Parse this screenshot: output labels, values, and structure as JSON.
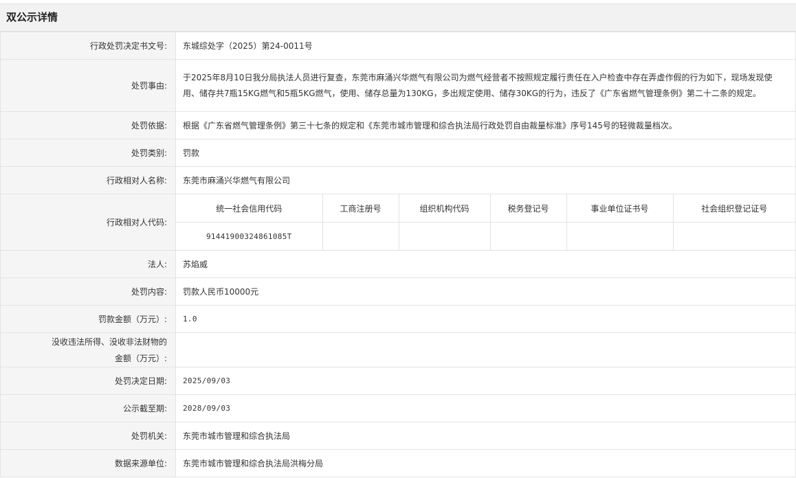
{
  "header": {
    "title": "双公示详情"
  },
  "rows": {
    "doc_no": {
      "label": "行政处罚决定书文号:",
      "value": "东城综处字（2025）第24-0011号"
    },
    "reason": {
      "label": "处罚事由:",
      "value": "于2025年8月10日我分局执法人员进行复查，东莞市麻涌兴华燃气有限公司为燃气经营者不按照规定履行责任在入户检查中存在弄虚作假的行为如下，现场发现使用、储存共7瓶15KG燃气和5瓶5KG燃气，使用、储存总量为130KG，多出规定使用、储存30KG的行为，违反了《广东省燃气管理条例》第二十二条的规定。"
    },
    "basis": {
      "label": "处罚依据:",
      "value": "根据《广东省燃气管理条例》第三十七条的规定和《东莞市城市管理和综合执法局行政处罚自由裁量标准》序号145号的轻微裁量档次。"
    },
    "category": {
      "label": "处罚类别:",
      "value": "罚款"
    },
    "party_name": {
      "label": "行政相对人名称:",
      "value": "东莞市麻涌兴华燃气有限公司"
    },
    "party_code": {
      "label": "行政相对人代码:",
      "headers": [
        "统一社会信用代码",
        "工商注册号",
        "组织机构代码",
        "税务登记号",
        "事业单位证书号",
        "社会组织登记证号"
      ],
      "values": [
        "91441900324861085T",
        "",
        "",
        "",
        "",
        ""
      ]
    },
    "legal_person": {
      "label": "法人:",
      "value": "苏焰威"
    },
    "content": {
      "label": "处罚内容:",
      "value": "罚款人民币10000元"
    },
    "fine": {
      "label": "罚款金额（万元）:",
      "value": "1.0"
    },
    "confiscation": {
      "label_line1": "没收违法所得、没收非法财物的",
      "label_line2": "金额（万元）:",
      "value": ""
    },
    "decision_date": {
      "label": "处罚决定日期:",
      "value": "2025/09/03"
    },
    "publicity_end": {
      "label": "公示截至期:",
      "value": "2028/09/03"
    },
    "authority": {
      "label": "处罚机关:",
      "value": "东莞市城市管理和综合执法局"
    },
    "source": {
      "label": "数据来源单位:",
      "value": "东莞市城市管理和综合执法局洪梅分局"
    }
  }
}
